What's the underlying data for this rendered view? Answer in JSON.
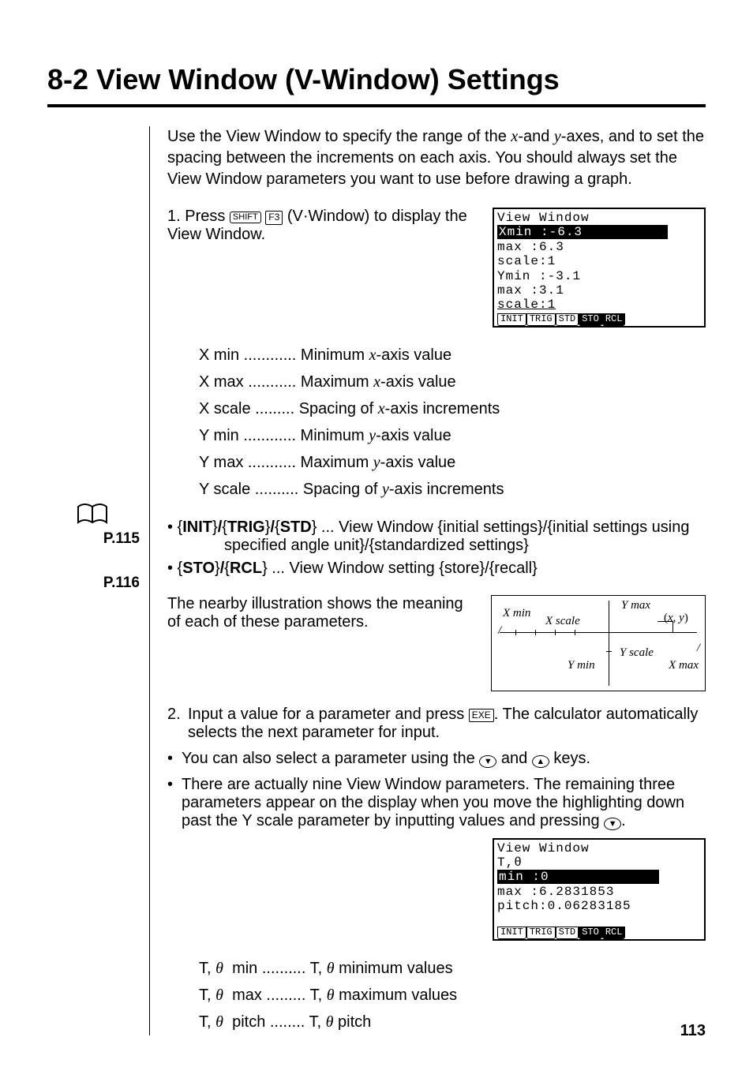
{
  "title": "8-2  View Window (V-Window) Settings",
  "intro": "Use the View Window to specify the range of the x-and y-axes, and to set the spacing between the increments on each axis. You should always set the View Window parameters you want to use before drawing a graph.",
  "step1_prefix": "1.  Press ",
  "step1_suffix": "(V·Window) to display the View Window.",
  "key_shift": "SHIFT",
  "key_f3": "F3",
  "key_exe": "EXE",
  "calc1": {
    "title": "View Window",
    "xmin_label": "Xmin  :",
    "xmin_val": "-6.3",
    "max1": " max  :6.3",
    "scale1": " scale:1",
    "ymin": "Ymin  :-3.1",
    "max2": " max  :3.1",
    "scale2": " scale:1",
    "sk": [
      "INIT",
      "TRIG",
      "STD",
      "STO",
      "RCL"
    ]
  },
  "defs": {
    "xmin": "X min ............ Minimum x-axis value",
    "xmax": "X max ........... Maximum x-axis value",
    "xscale": "X scale ......... Spacing of x-axis increments",
    "ymin": "Y min ............ Minimum y-axis value",
    "ymax": "Y max ........... Maximum y-axis value",
    "yscale": "Y scale .......... Spacing of y-axis increments"
  },
  "ref115": "P.115",
  "ref116": "P.116",
  "bullet1_a": "• {INIT}/{TRIG}/{STD} ... View Window {initial settings}/{initial settings using",
  "bullet1_b": "specified angle unit}/{standardized settings}",
  "bullet2": "• {STO}/{RCL} ... View Window setting {store}/{recall}",
  "illus_text": "The nearby illustration shows the meaning of each of these parameters.",
  "diagram": {
    "xmin": "X min",
    "xscale": "X scale",
    "ymax": "Y max",
    "xy": "(x, y)",
    "ymin": "Y min",
    "yscale": "Y scale",
    "xmax": "X max"
  },
  "step2_a": "Input a value for a parameter and press ",
  "step2_b": ". The calculator automatically selects the next parameter for input.",
  "sub1": "You can also select a parameter using the ",
  "sub1_mid": " and ",
  "sub1_end": " keys.",
  "sub2": "There are actually nine View Window parameters. The remaining three parameters appear on the display when you move the highlighting down past the Y scale parameter by inputting values and pressing ",
  "sub2_end": ".",
  "calc2": {
    "title": "View Window",
    "ttheta": "T,θ",
    "min_label": " min  :",
    "min_val": "0",
    "max": " max  :6.2831853",
    "pitch": " pitch:0.06283185",
    "sk": [
      "INIT",
      "TRIG",
      "STD",
      "STO",
      "RCL"
    ]
  },
  "defs2": {
    "tmin": "T, θ  min .......... T, θ minimum values",
    "tmax": "T, θ  max ......... T, θ maximum values",
    "tpitch": "T, θ  pitch ........ T, θ pitch"
  },
  "pagenum": "113"
}
